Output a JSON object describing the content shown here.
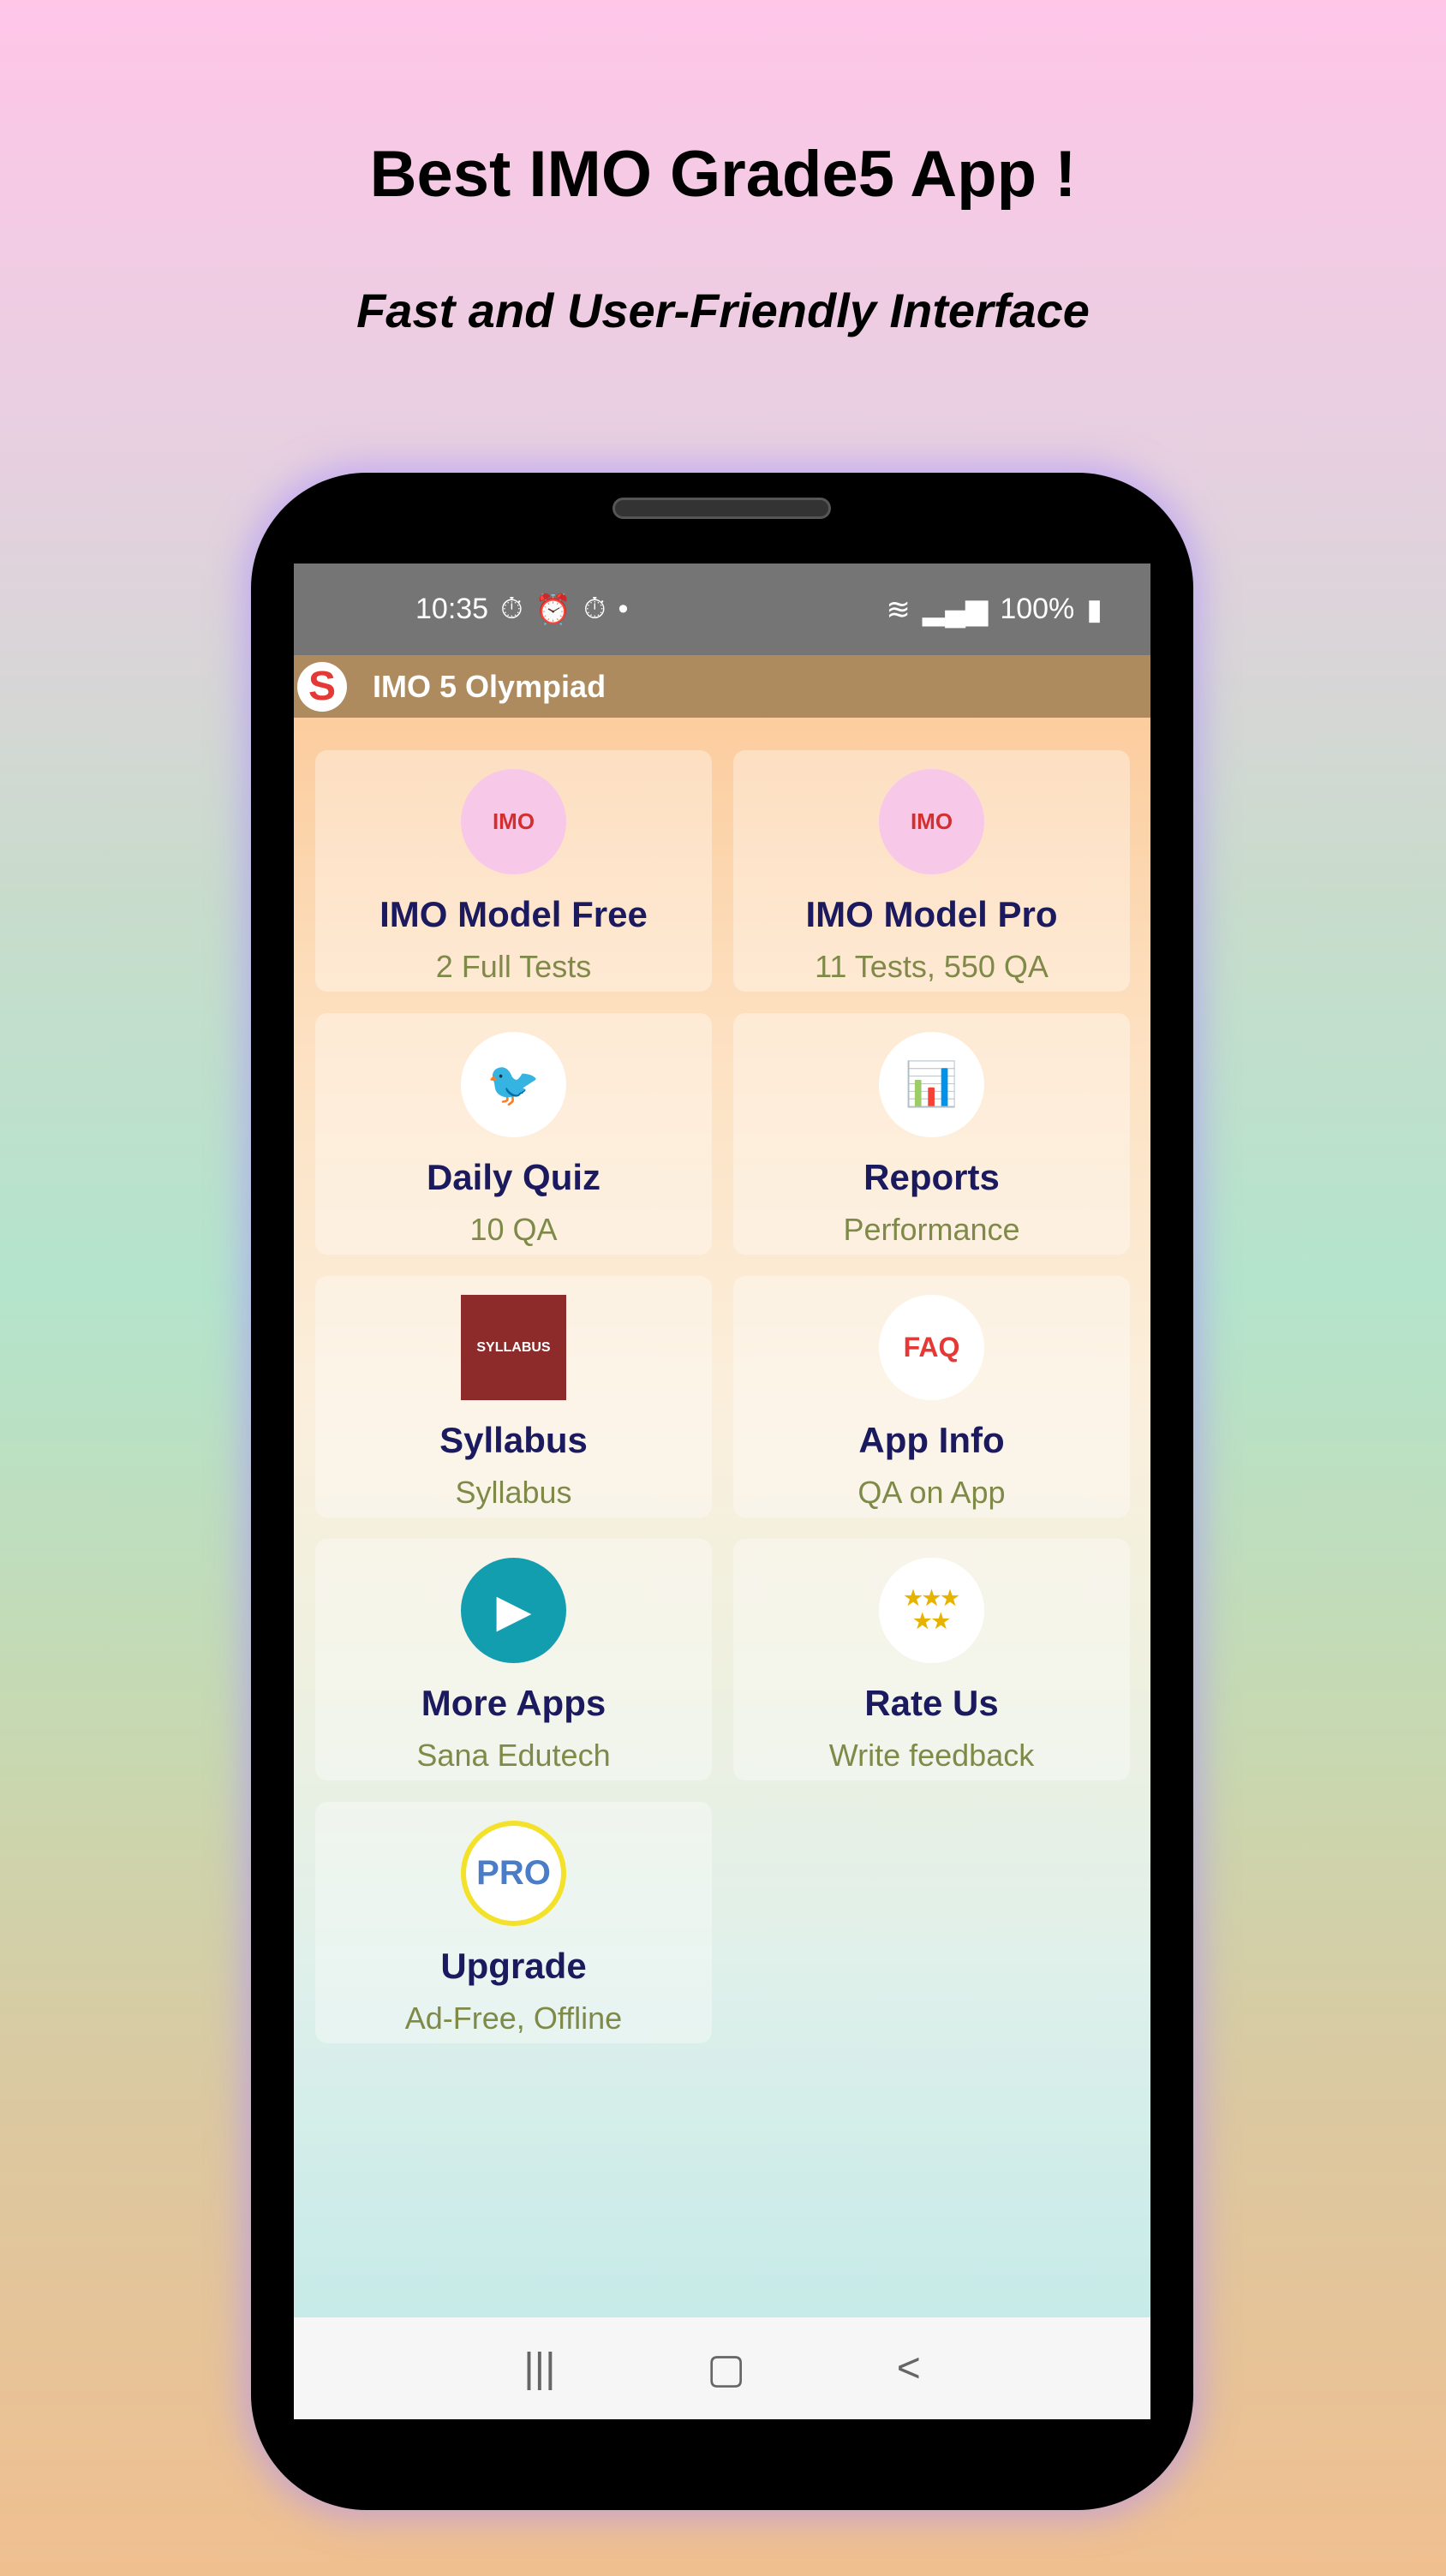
{
  "promo": {
    "headline": "Best IMO Grade5  App !",
    "subline": "Fast and User-Friendly Interface"
  },
  "status": {
    "time": "10:35",
    "icons": [
      "stopwatch-icon",
      "alarm-icon",
      "stopwatch-icon",
      "dot-icon"
    ],
    "battery": "100%"
  },
  "appbar": {
    "title": "IMO 5 Olympiad",
    "logo": "S"
  },
  "cards": [
    {
      "title": "IMO Model Free",
      "subtitle": "2 Full Tests",
      "icon": "clipboard-icon",
      "badge": "IMO"
    },
    {
      "title": "IMO Model Pro",
      "subtitle": "11 Tests, 550 QA",
      "icon": "clipboard-icon",
      "badge": "IMO"
    },
    {
      "title": "Daily Quiz",
      "subtitle": "10 QA",
      "icon": "bird-icon"
    },
    {
      "title": "Reports",
      "subtitle": "Performance",
      "icon": "bar-chart-icon"
    },
    {
      "title": "Syllabus",
      "subtitle": "Syllabus",
      "icon": "books-icon",
      "badge": "SYLLABUS"
    },
    {
      "title": "App Info",
      "subtitle": "QA on App",
      "icon": "faq-icon",
      "badge": "FAQ"
    },
    {
      "title": "More Apps",
      "subtitle": "Sana Edutech",
      "icon": "play-icon"
    },
    {
      "title": "Rate Us",
      "subtitle": "Write feedback",
      "icon": "stars-icon",
      "badge": "★★★\n★★"
    },
    {
      "title": "Upgrade",
      "subtitle": "Ad-Free, Offline",
      "icon": "pro-icon",
      "badge": "PRO"
    }
  ],
  "nav": {
    "recents": "|||",
    "home": "▢",
    "back": "<"
  },
  "colors": {
    "title": "#1b1a5e",
    "subtitle": "#7f8a48",
    "statusbar": "#757575",
    "appbar": "#ad8b5e"
  }
}
